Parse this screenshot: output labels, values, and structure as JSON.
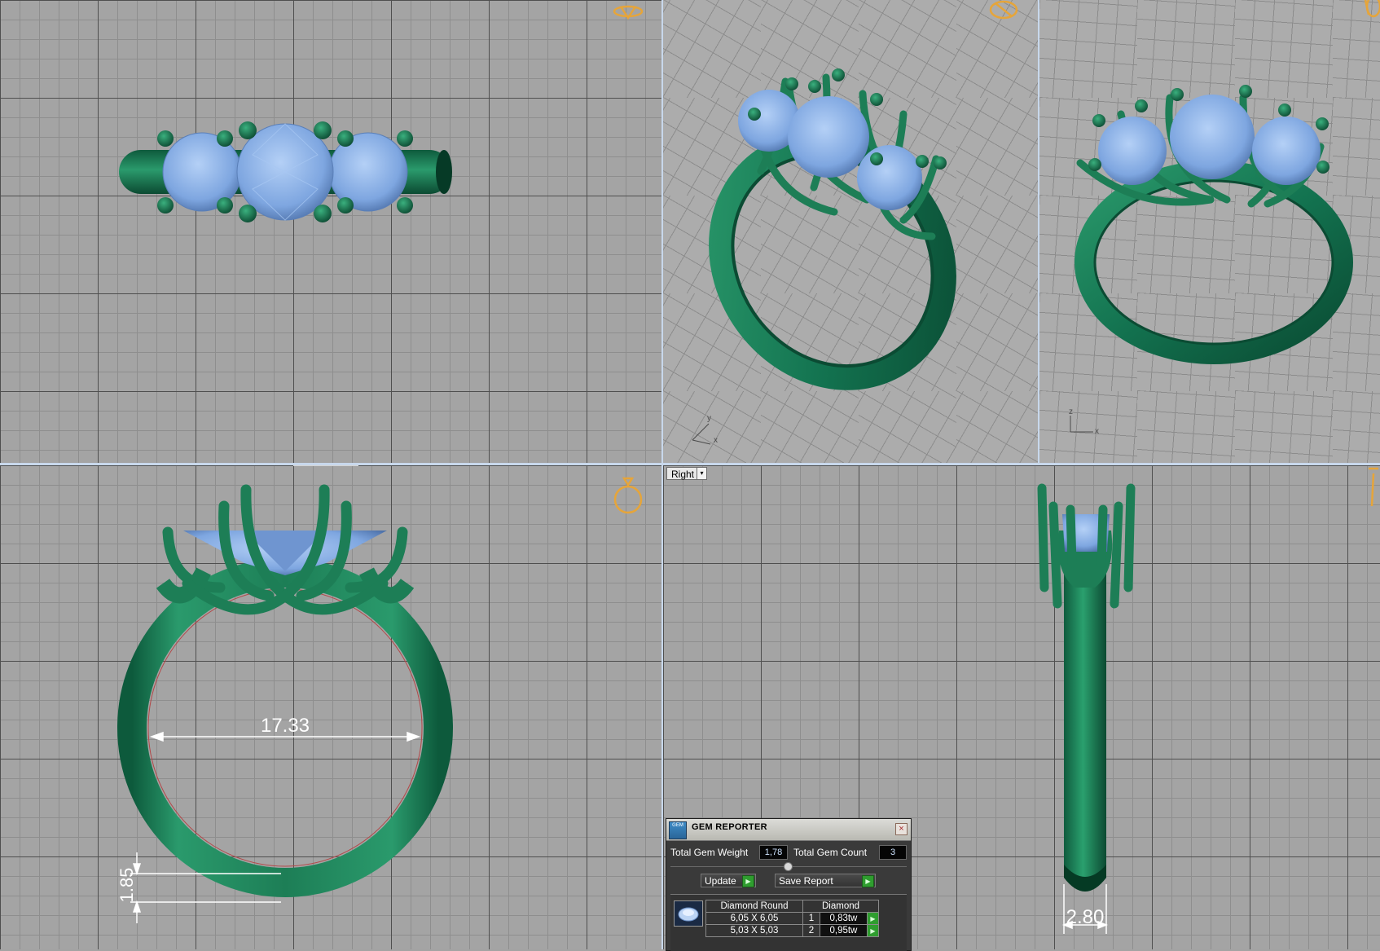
{
  "viewports": {
    "bottom_right": {
      "view_label": "Right",
      "view_arrow": "▾"
    },
    "perspective_1": {
      "axis_y": "y",
      "axis_x": "x"
    },
    "perspective_2": {
      "axis_z": "z",
      "axis_x": "x"
    }
  },
  "dimensions": {
    "inner_diameter": "17.33",
    "shank_thickness": "1.85",
    "shank_width": "2.80"
  },
  "gem_reporter": {
    "title": "GEM REPORTER",
    "logo_text": "GEM",
    "close": "×",
    "total_weight_label": "Total Gem Weight",
    "total_weight_value": "1,78",
    "total_count_label": "Total Gem Count",
    "total_count_value": "3",
    "update_label": "Update",
    "save_report_label": "Save Report",
    "table_header": {
      "shape": "Diamond Round",
      "material": "Diamond"
    },
    "rows": [
      {
        "size": "6,05 X 6,05",
        "count": "1",
        "weight": "0,83tw"
      },
      {
        "size": "5,03 X 5,03",
        "count": "2",
        "weight": "0,95tw"
      }
    ]
  },
  "colors": {
    "metal": "#1f7e58",
    "gem": "#8eb6ee",
    "viewport_bg": "#a4a4a4",
    "divider": "#c8d8ec",
    "gizmo": "#e6a53a"
  }
}
